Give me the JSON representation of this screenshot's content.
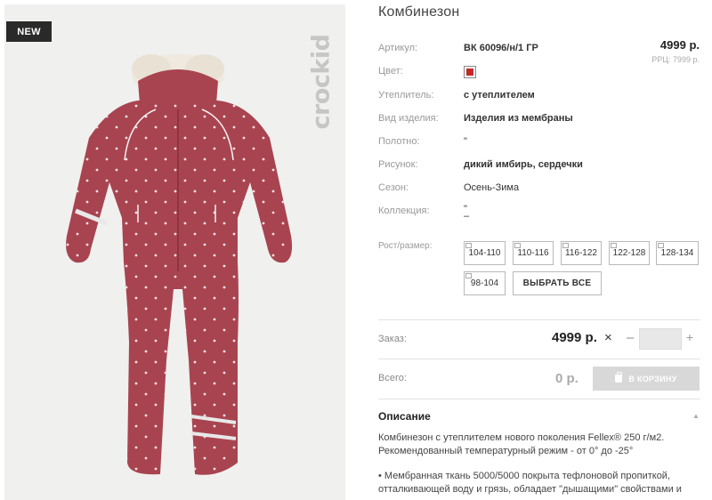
{
  "image": {
    "badge": "NEW",
    "brand": "crockid"
  },
  "product": {
    "title": "Комбинезон",
    "price": "4999 р.",
    "rrp": "РРЦ: 7999 р."
  },
  "attributes": [
    {
      "label": "Артикул:",
      "value": "ВК 60096/н/1 ГР",
      "bold": true
    },
    {
      "label": "Цвет:",
      "value": "",
      "color": "#c62828"
    },
    {
      "label": "Утеплитель:",
      "value": "с утеплителем",
      "bold": true
    },
    {
      "label": "Вид изделия:",
      "value": "Изделия из мембраны",
      "bold": true
    },
    {
      "label": "Полотно:",
      "value": "\"",
      "bold": false
    },
    {
      "label": "Рисунок:",
      "value": "дикий имбирь, сердечки",
      "bold": true
    },
    {
      "label": "Сезон:",
      "value": "Осень-Зима",
      "bold": false
    },
    {
      "label": "Коллекция:",
      "value": "\"",
      "value2": "–",
      "bold": false
    }
  ],
  "sizes": {
    "label": "Рост/размер:",
    "options": [
      "104-110",
      "110-116",
      "116-122",
      "122-128",
      "128-134",
      "98-104"
    ],
    "select_all": "ВЫБРАТЬ ВСЕ"
  },
  "order": {
    "label": "Заказ:",
    "price": "4999 р.",
    "times": "×",
    "minus": "–",
    "plus": "+",
    "quantity": ""
  },
  "total": {
    "label": "Всего:",
    "value": "0 р.",
    "cart_button": "В КОРЗИНУ"
  },
  "description": {
    "heading": "Описание",
    "paragraphs": [
      "Комбинезон с утеплителем нового поколения Fellex® 250 г/м2.",
      "Рекомендованный температурный режим - от 0° до -25°",
      "• Мембранная ткань 5000/5000 покрыта тефлоновой пропиткой,",
      "отталкивающей воду и грязь, обладает \"дышащими\" свойствами и"
    ]
  },
  "colors": {
    "suit": "#a84450",
    "suit_shadow": "#8f3540",
    "fur": "#efe9e0",
    "badge_bg": "#2a2a2a",
    "cart_disabled": "#d8d8d8"
  }
}
